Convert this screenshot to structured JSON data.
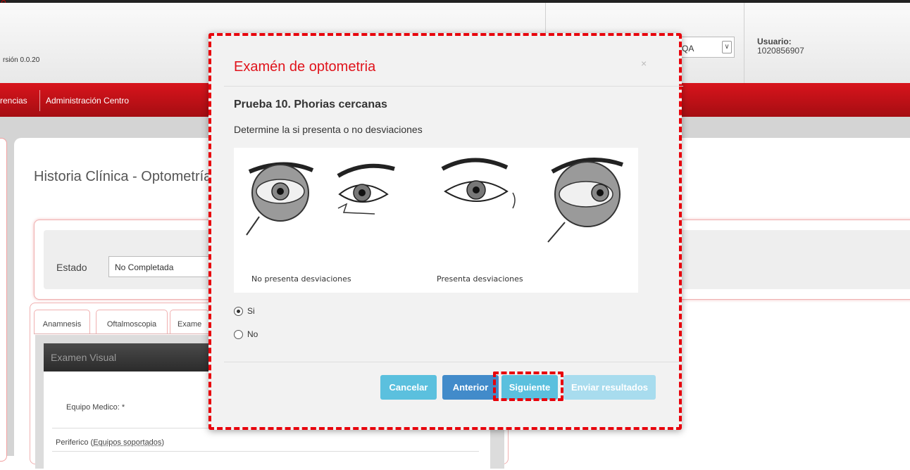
{
  "header": {
    "version": "rsión 0.0.20",
    "environment": "QA",
    "user_label": "Usuario:",
    "user_id": "1020856907"
  },
  "nav": {
    "items": [
      "rencias",
      "Administración Centro"
    ]
  },
  "page": {
    "title": "Historia Clínica - Optometría",
    "estado_label": "Estado",
    "estado_value": "No Completada",
    "tabs": [
      "Anamnesis",
      "Oftalmoscopia",
      "Exame"
    ],
    "card_title": "Examen Visual",
    "equipo_label": "Equipo Medico: *",
    "periferico_label": "Periferico (",
    "periferico_link": "Equipos soportados",
    "periferico_close": ")"
  },
  "modal": {
    "title": "Examén de optometria",
    "close": "×",
    "test_title": "Prueba 10. Phorias cercanas",
    "test_desc": "Determine la si presenta o no desviaciones",
    "caption_left": "No presenta desviaciones",
    "caption_right": "Presenta desviaciones",
    "options": [
      {
        "label": "Si",
        "selected": true
      },
      {
        "label": "No",
        "selected": false
      }
    ],
    "buttons": {
      "cancel": "Cancelar",
      "prev": "Anterior",
      "next": "Siguiente",
      "send": "Enviar resultados"
    }
  },
  "colors": {
    "brand_red": "#d8141c",
    "highlight": "#e8000b",
    "info_button": "#5bc0de",
    "primary_button": "#428bca"
  }
}
